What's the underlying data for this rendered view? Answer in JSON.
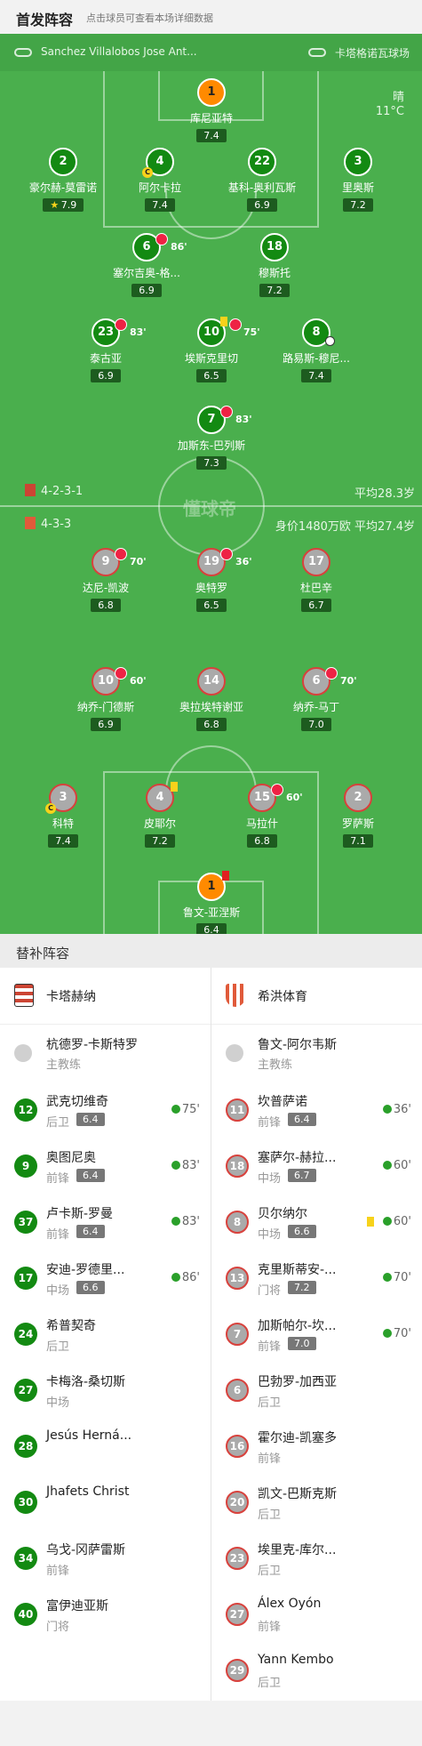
{
  "header": {
    "title": "首发阵容",
    "subtitle": "点击球员可查看本场详细数据"
  },
  "teambar": {
    "home_coach": "Sanchez Villalobos Jose Ant...",
    "stadium": "卡塔格诺瓦球场"
  },
  "weather": {
    "cond": "晴",
    "temp": "11°C"
  },
  "watermark": "懂球帝",
  "home_formation": {
    "form": "4-2-3-1",
    "avg": "平均28.3岁"
  },
  "away_formation": {
    "form": "4-3-3",
    "avg": "身价1480万欧 平均27.4岁"
  },
  "home_players": [
    {
      "num": "1",
      "name": "库尼亚特",
      "rating": "7.4"
    },
    {
      "num": "2",
      "name": "豪尔赫-莫雷诺",
      "rating": "7.9"
    },
    {
      "num": "4",
      "name": "阿尔卡拉",
      "rating": "7.4"
    },
    {
      "num": "22",
      "name": "基科-奥利瓦斯",
      "rating": "6.9"
    },
    {
      "num": "3",
      "name": "里奥斯",
      "rating": "7.2"
    },
    {
      "num": "6",
      "name": "塞尔吉奥-格...",
      "rating": "6.9",
      "sub": "86'"
    },
    {
      "num": "18",
      "name": "穆斯托",
      "rating": "7.2"
    },
    {
      "num": "23",
      "name": "泰古亚",
      "rating": "6.9",
      "sub": "83'"
    },
    {
      "num": "10",
      "name": "埃斯克里切",
      "rating": "6.5",
      "sub": "75'"
    },
    {
      "num": "8",
      "name": "路易斯-穆尼...",
      "rating": "7.4"
    },
    {
      "num": "7",
      "name": "加斯东-巴列斯",
      "rating": "7.3",
      "sub": "83'"
    }
  ],
  "away_players": [
    {
      "num": "9",
      "name": "达尼-凯波",
      "rating": "6.8",
      "sub": "70'"
    },
    {
      "num": "19",
      "name": "奥特罗",
      "rating": "6.5",
      "sub": "36'"
    },
    {
      "num": "17",
      "name": "杜巴辛",
      "rating": "6.7"
    },
    {
      "num": "10",
      "name": "纳乔-门德斯",
      "rating": "6.9",
      "sub": "60'"
    },
    {
      "num": "14",
      "name": "奥拉埃特谢亚",
      "rating": "6.8"
    },
    {
      "num": "6",
      "name": "纳乔-马丁",
      "rating": "7.0",
      "sub": "70'"
    },
    {
      "num": "3",
      "name": "科特",
      "rating": "7.4"
    },
    {
      "num": "4",
      "name": "皮耶尔",
      "rating": "7.2"
    },
    {
      "num": "15",
      "name": "马拉什",
      "rating": "6.8",
      "sub": "60'"
    },
    {
      "num": "2",
      "name": "罗萨斯",
      "rating": "7.1"
    },
    {
      "num": "1",
      "name": "鲁文-亚涅斯",
      "rating": "6.4"
    }
  ],
  "captain_mark": "C",
  "subs": {
    "title": "替补阵容",
    "home_team": "卡塔赫纳",
    "away_team": "希洪体育",
    "home_coach": {
      "name": "杭德罗-卡斯特罗",
      "role": "主教练"
    },
    "away_coach": {
      "name": "鲁文-阿尔韦斯",
      "role": "主教练"
    },
    "home": [
      {
        "num": "12",
        "name": "武克切维奇",
        "pos": "后卫",
        "rating": "6.4",
        "in": "75'"
      },
      {
        "num": "9",
        "name": "奥图尼奥",
        "pos": "前锋",
        "rating": "6.4",
        "in": "83'"
      },
      {
        "num": "37",
        "name": "卢卡斯-罗曼",
        "pos": "前锋",
        "rating": "6.4",
        "in": "83'"
      },
      {
        "num": "17",
        "name": "安迪-罗德里...",
        "pos": "中场",
        "rating": "6.6",
        "in": "86'"
      },
      {
        "num": "24",
        "name": "希普契奇",
        "pos": "后卫"
      },
      {
        "num": "27",
        "name": "卡梅洛-桑切斯",
        "pos": "中场"
      },
      {
        "num": "28",
        "name": "Jesús Herná...",
        "pos": ""
      },
      {
        "num": "30",
        "name": "Jhafets Christ",
        "pos": ""
      },
      {
        "num": "34",
        "name": "乌戈-冈萨雷斯",
        "pos": "前锋"
      },
      {
        "num": "40",
        "name": "富伊迪亚斯",
        "pos": "门将"
      }
    ],
    "away": [
      {
        "num": "11",
        "name": "坎普萨诺",
        "pos": "前锋",
        "rating": "6.4",
        "in": "36'"
      },
      {
        "num": "18",
        "name": "塞萨尔-赫拉...",
        "pos": "中场",
        "rating": "6.7",
        "in": "60'"
      },
      {
        "num": "8",
        "name": "贝尔纳尔",
        "pos": "中场",
        "rating": "6.6",
        "in": "60'",
        "card": "yellow"
      },
      {
        "num": "13",
        "name": "克里斯蒂安-...",
        "pos": "门将",
        "rating": "7.2",
        "in": "70'"
      },
      {
        "num": "7",
        "name": "加斯帕尔-坎...",
        "pos": "前锋",
        "rating": "7.0",
        "in": "70'"
      },
      {
        "num": "6",
        "name": "巴勃罗-加西亚",
        "pos": "后卫"
      },
      {
        "num": "16",
        "name": "霍尔迪-凯塞多",
        "pos": "前锋"
      },
      {
        "num": "20",
        "name": "凯文-巴斯克斯",
        "pos": "后卫"
      },
      {
        "num": "23",
        "name": "埃里克-库尔...",
        "pos": "后卫"
      },
      {
        "num": "27",
        "name": "Álex Oyón",
        "pos": "前锋"
      },
      {
        "num": "29",
        "name": "Yann Kembo",
        "pos": "后卫"
      }
    ]
  }
}
